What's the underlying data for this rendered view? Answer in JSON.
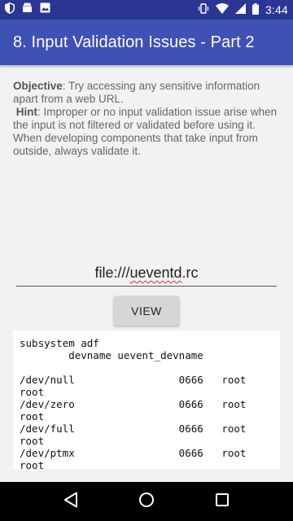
{
  "status_bar": {
    "time": "3:44",
    "icons": [
      "shield-icon",
      "android-icon",
      "image-icon",
      "vibrate-icon",
      "wifi-icon",
      "signal-icon",
      "battery-icon"
    ]
  },
  "app_bar": {
    "title": "8. Input Validation Issues - Part 2"
  },
  "description": {
    "objective_label": "Objective",
    "objective_text": ": Try accessing any sensitive information apart from a web URL.",
    "hint_label": "Hint",
    "hint_text": ": Improper or no input validation issue arise when the input is not filtered or validated before using it. When developing components that take input from outside, always validate it."
  },
  "url_input": {
    "prefix": "file:///",
    "misspelled": "ueventd",
    "suffix": ".rc"
  },
  "view_button": {
    "label": "VIEW"
  },
  "output": {
    "text": "subsystem adf\n        devname uevent_devname\n\n/dev/null                 0666   root\nroot\n/dev/zero                 0666   root\nroot\n/dev/full                 0666   root\nroot\n/dev/ptmx                 0666   root\nroot"
  },
  "colors": {
    "status_bar": "#2b3694",
    "app_bar": "#3f51b5",
    "background": "#f2f2f2"
  }
}
